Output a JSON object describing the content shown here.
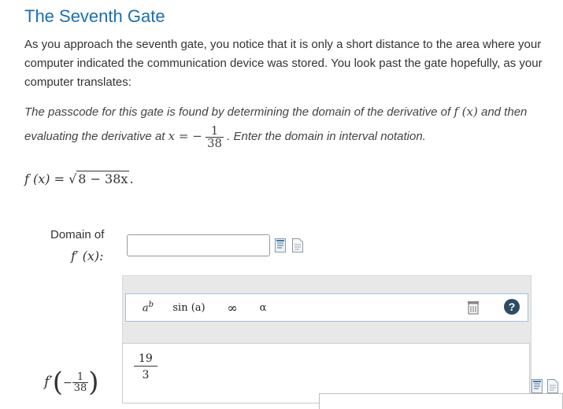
{
  "page": {
    "title": "The Seventh Gate",
    "intro": "As you approach the seventh gate, you notice that it is only a short distance to the area where your computer indicated the communication device was stored. You look past the gate hopefully, as your computer translates:",
    "prompt": {
      "part1": "The passcode for this gate is found by determining the domain of the derivative of",
      "f_of_x": "f (x)",
      "part2": "and then evaluating the derivative at",
      "x_eq": "x = −",
      "frac_num": "1",
      "frac_den": "38",
      "part3": ". Enter the domain in interval notation."
    },
    "function": {
      "lhs": "f (x) = ",
      "sqrt_symbol": "√",
      "radicand": "8 − 38x",
      "tail": "."
    }
  },
  "domain_question": {
    "label": "Domain of",
    "fprime": "f′ (x):",
    "input_value": "",
    "input_placeholder": ""
  },
  "math_toolbar": {
    "buttons": [
      {
        "label": "a^b",
        "icon": "superscript-icon"
      },
      {
        "label": "sin (a)",
        "icon": "function-icon"
      },
      {
        "label": "∞",
        "icon": "infinity-icon"
      },
      {
        "label": "α",
        "icon": "greek-letter-icon"
      }
    ],
    "trash_icon": "trash-icon",
    "help_label": "?"
  },
  "editor": {
    "numerator": "19",
    "denominator": "3"
  },
  "evaluation": {
    "fprime": "f′",
    "open_paren": "(",
    "neg": "−",
    "frac_num": "1",
    "frac_den": "38",
    "close_paren": ")"
  },
  "colors": {
    "title_blue": "#1a6fb3",
    "toolbar_border": "#9ec3e6",
    "help_button": "#2d4a66",
    "panel_gray": "#e8e8e8"
  }
}
